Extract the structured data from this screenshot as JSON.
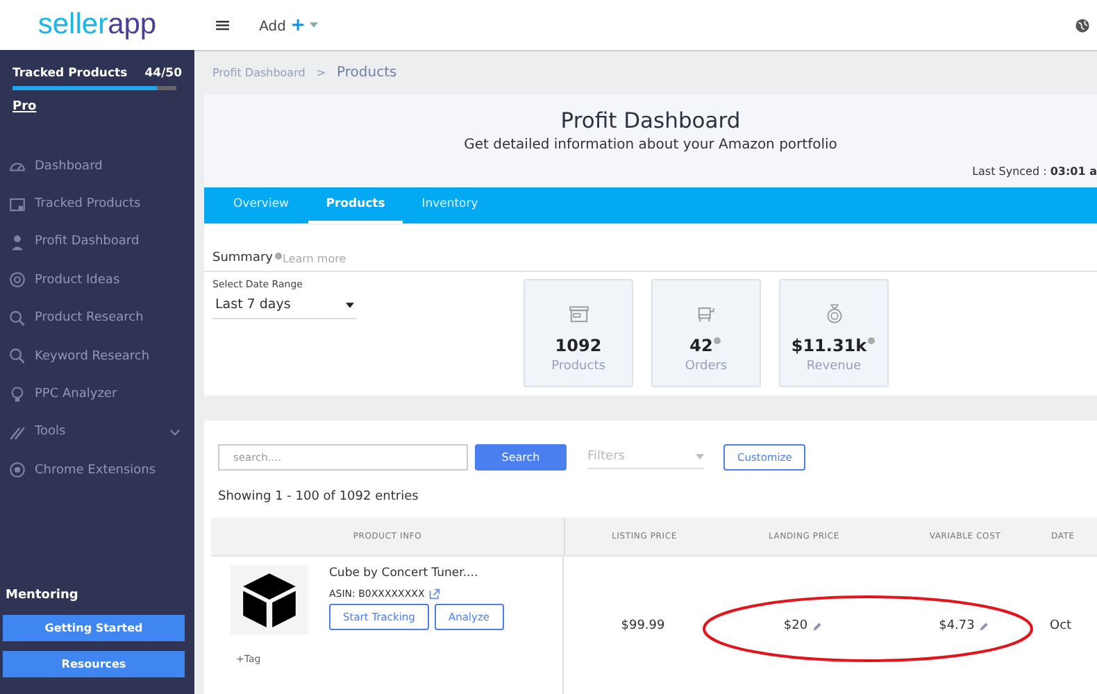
{
  "logo": {
    "part_1": "seller",
    "part_2": "app"
  },
  "topbar": {
    "menu_glyph": "≡",
    "add_label": "Add",
    "add_glyph": "+"
  },
  "sidebar": {
    "tracked": {
      "label": "Tracked Products",
      "count": "44/50",
      "level": 0.88
    },
    "plan": "Pro",
    "items": [
      {
        "label": "Dashboard",
        "expandable": false
      },
      {
        "label": "Tracked Products",
        "expandable": false
      },
      {
        "label": "Profit Dashboard",
        "expandable": false
      },
      {
        "label": "Product Ideas",
        "expandable": false
      },
      {
        "label": "Product Research",
        "expandable": false
      },
      {
        "label": "Keyword Research",
        "expandable": false
      },
      {
        "label": "PPC Analyzer",
        "expandable": false
      },
      {
        "label": "Tools",
        "expandable": true
      },
      {
        "label": "Chrome Extensions",
        "expandable": false
      }
    ],
    "mentoring": {
      "title": "Mentoring",
      "buttons": [
        "Getting Started",
        "Resources"
      ]
    }
  },
  "breadcrumb": {
    "parent": "Profit Dashboard",
    "separator": ">",
    "current": "Products"
  },
  "header": {
    "title": "Profit Dashboard",
    "subtitle": "Get detailed information about your Amazon portfolio",
    "synced_label": "Last Synced : ",
    "synced_value": "03:01 a"
  },
  "tabs": [
    {
      "label": "Overview",
      "selected": false
    },
    {
      "label": "Products",
      "selected": true
    },
    {
      "label": "Inventory",
      "selected": false
    }
  ],
  "summary": {
    "title": "Summary",
    "link": "Learn more",
    "date_range": {
      "label": "Select Date Range",
      "value": "Last 7 days"
    },
    "stats": [
      {
        "value": "1092",
        "label": "Products",
        "info": false
      },
      {
        "value": "42",
        "label": "Orders",
        "info": true
      },
      {
        "value": "$11.31k",
        "label": "Revenue",
        "info": true
      }
    ]
  },
  "toolbar": {
    "search_placeholder": "search....",
    "search_button": "Search",
    "filters_placeholder": "Filters",
    "customize_button": "Customize"
  },
  "entries": "Showing 1 - 100 of 1092 entries",
  "table": {
    "columns": [
      "PRODUCT INFO",
      "LISTING PRICE",
      "LANDING PRICE",
      "VARIABLE COST",
      "DATE"
    ],
    "rows": [
      {
        "title": "Cube by Concert Tuner....",
        "asin": "ASIN: B0XXXXXXXX",
        "actions": [
          "Start Tracking",
          "Analyze"
        ],
        "tag": "+Tag",
        "listing_price": "$99.99",
        "landing_price": "$20",
        "variable_cost": "$4.73",
        "date": "Oct"
      }
    ]
  }
}
